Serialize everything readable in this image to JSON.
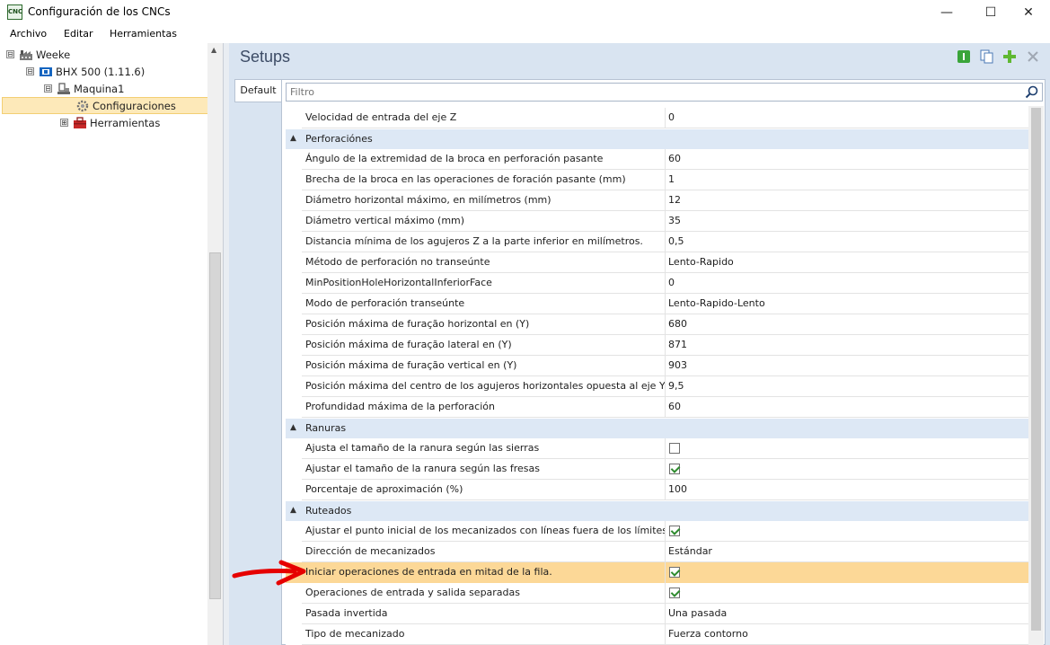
{
  "window": {
    "app_icon_text": "CNC",
    "title": "Configuración de los CNCs",
    "minimize": "—",
    "maximize": "☐",
    "close": "✕"
  },
  "menu": [
    "Archivo",
    "Editar",
    "Herramientas"
  ],
  "tree": {
    "items": [
      {
        "label": "Weeke",
        "expander": "⊟"
      },
      {
        "label": "BHX 500 (1.11.6)",
        "expander": "⊟"
      },
      {
        "label": "Maquina1",
        "expander": "⊟"
      },
      {
        "label": "Configuraciones",
        "expander": ""
      },
      {
        "label": "Herramientas",
        "expander": "⊞"
      }
    ]
  },
  "setups": {
    "title": "Setups",
    "tab": "Default",
    "filter_placeholder": "Filtro"
  },
  "grid": {
    "top_row": {
      "name": "Velocidad de entrada del eje Z",
      "value": "0"
    },
    "categories": [
      {
        "label": "Perforaciónes",
        "rows": [
          {
            "name": "Ángulo de la extremidad de la broca en perforación pasante",
            "value": "60"
          },
          {
            "name": "Brecha de la broca en las operaciones de foración pasante (mm)",
            "value": "1"
          },
          {
            "name": "Diámetro horizontal máximo, en milímetros (mm)",
            "value": "12"
          },
          {
            "name": "Diámetro vertical máximo (mm)",
            "value": "35"
          },
          {
            "name": "Distancia mínima de los agujeros Z a la parte inferior en milímetros.",
            "value": "0,5"
          },
          {
            "name": "Método de perforación no transeúnte",
            "value": "Lento-Rapido"
          },
          {
            "name": "MinPositionHoleHorizontalInferiorFace",
            "value": "0"
          },
          {
            "name": "Modo de perforación transeúnte",
            "value": "Lento-Rapido-Lento"
          },
          {
            "name": "Posición máxima de furação horizontal en (Y)",
            "value": "680"
          },
          {
            "name": "Posición máxima de furação lateral en (Y)",
            "value": "871"
          },
          {
            "name": "Posición máxima de furação vertical en (Y)",
            "value": "903"
          },
          {
            "name": "Posición máxima del centro de los agujeros horizontales opuesta al eje Y de la...",
            "value": "9,5"
          },
          {
            "name": "Profundidad máxima de la perforación",
            "value": "60"
          }
        ]
      },
      {
        "label": "Ranuras",
        "rows": [
          {
            "name": "Ajusta el tamaño de la ranura según las sierras",
            "checkbox": false
          },
          {
            "name": "Ajustar el tamaño de la ranura según las fresas",
            "checkbox": true
          },
          {
            "name": "Porcentaje de aproximación (%)",
            "value": "100"
          }
        ]
      },
      {
        "label": "Ruteados",
        "rows": [
          {
            "name": "Ajustar el punto inicial de los mecanizados con líneas fuera de los límites de la...",
            "checkbox": true
          },
          {
            "name": "Dirección de mecanizados",
            "value": "Estándar"
          },
          {
            "name": "Iniciar operaciones de entrada en mitad de la fila.",
            "checkbox": true,
            "highlighted": true
          },
          {
            "name": "Operaciones de entrada y salida separadas",
            "checkbox": true
          },
          {
            "name": "Pasada invertida",
            "value": "Una pasada"
          },
          {
            "name": "Tipo de mecanizado",
            "value": "Fuerza contorno"
          }
        ]
      }
    ]
  },
  "colors": {
    "accent_selection": "#fde9b9",
    "highlight_row": "#fcd897",
    "category_band": "#dde8f5",
    "annotation_arrow": "#e60000"
  }
}
